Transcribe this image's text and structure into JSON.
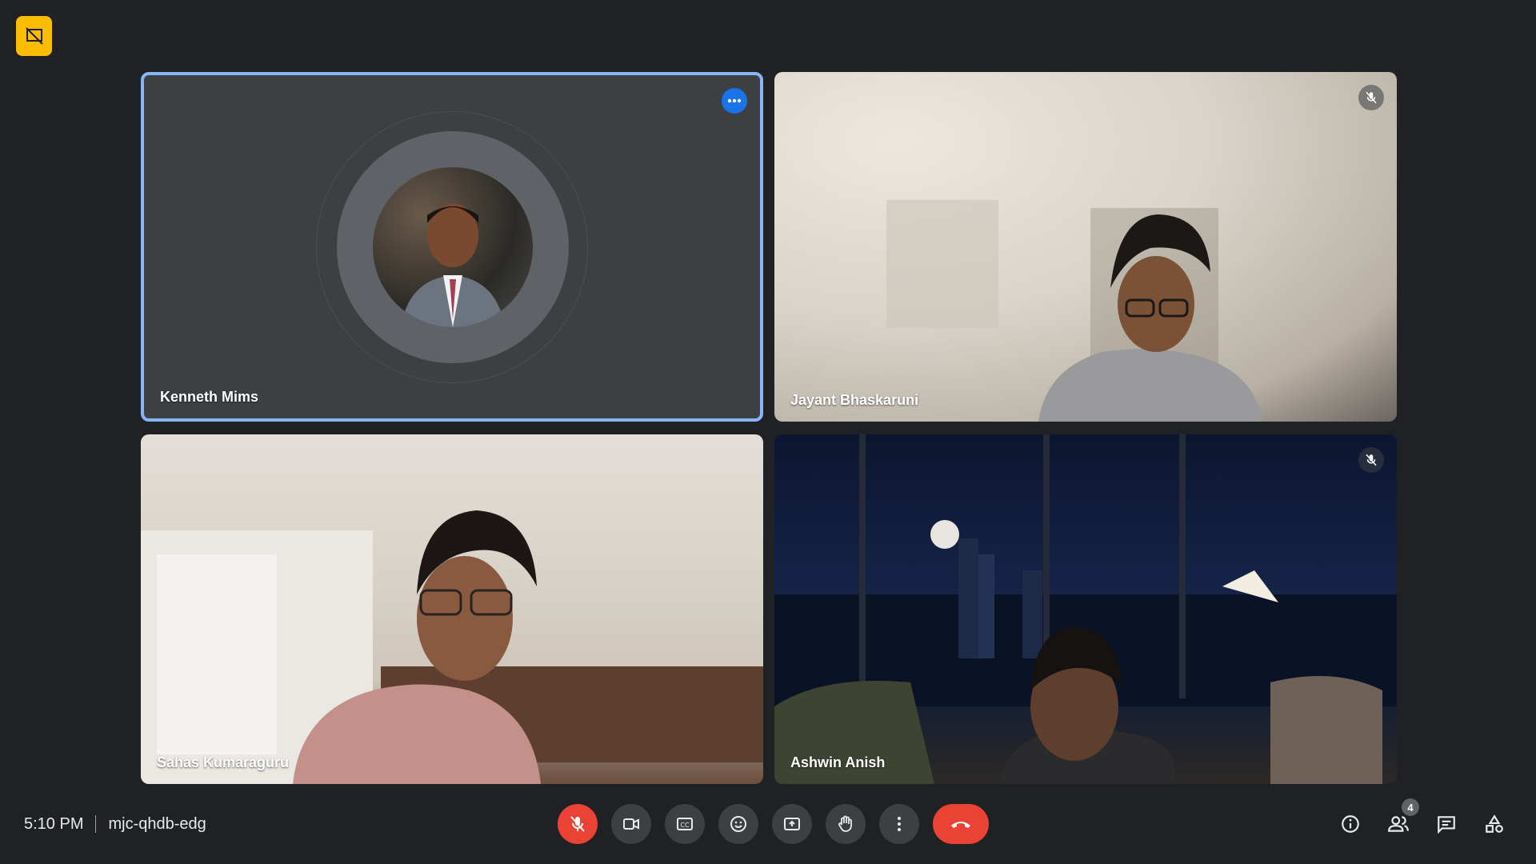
{
  "meeting": {
    "time": "5:10 PM",
    "code": "mjc-qhdb-edg"
  },
  "participants": [
    {
      "name": "Kenneth Mims",
      "status": "active-speaker-options"
    },
    {
      "name": "Jayant Bhaskaruni",
      "status": "muted"
    },
    {
      "name": "Sahas Kumaraguru",
      "status": "unmuted"
    },
    {
      "name": "Ashwin Anish",
      "status": "muted"
    }
  ],
  "people_count": "4",
  "controls": [
    "mic-off-icon",
    "camera-icon",
    "captions-icon",
    "emoji-icon",
    "present-icon",
    "raise-hand-icon",
    "more-vert-icon",
    "end-call-icon"
  ],
  "right_tools": [
    "info-icon",
    "people-icon",
    "chat-icon",
    "activities-icon"
  ],
  "colors": {
    "accent": "#8ab4f8",
    "danger": "#ea4335",
    "badge": "#fbbc04",
    "background": "#202124"
  }
}
